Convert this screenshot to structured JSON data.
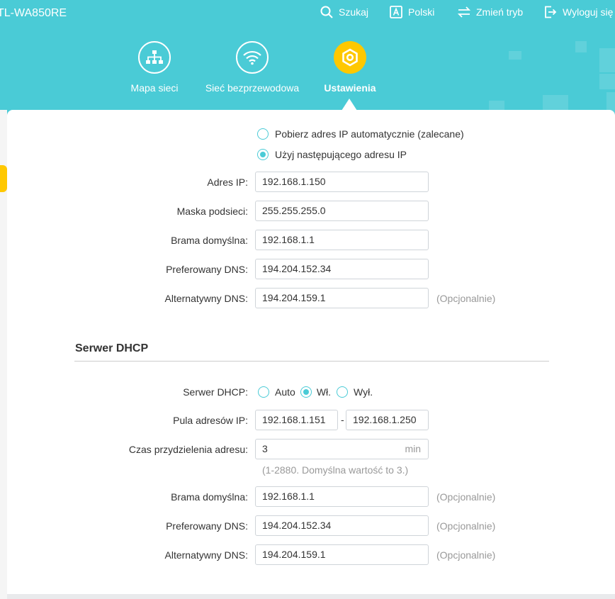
{
  "header": {
    "brand": "TL-WA850RE",
    "top_nav": [
      {
        "label": "Szukaj",
        "icon": "search-icon"
      },
      {
        "label": "Polski",
        "icon": "language-icon"
      },
      {
        "label": "Zmień tryb",
        "icon": "mode-switch-icon"
      },
      {
        "label": "Wyloguj się",
        "icon": "logout-icon"
      }
    ],
    "main_nav": [
      {
        "label": "Mapa sieci",
        "icon": "network-map-icon",
        "active": false
      },
      {
        "label": "Sieć bezprzewodowa",
        "icon": "wifi-icon",
        "active": false
      },
      {
        "label": "Ustawienia",
        "icon": "settings-icon",
        "active": true
      }
    ]
  },
  "ip_config": {
    "option_auto": "Pobierz adres IP automatycznie (zalecane)",
    "option_manual": "Użyj następującego adresu IP",
    "selected": "manual",
    "ip_address_label": "Adres IP:",
    "ip_address": "192.168.1.150",
    "subnet_label": "Maska podsieci:",
    "subnet": "255.255.255.0",
    "gateway_label": "Brama domyślna:",
    "gateway": "192.168.1.1",
    "dns1_label": "Preferowany DNS:",
    "dns1": "194.204.152.34",
    "dns2_label": "Alternatywny DNS:",
    "dns2": "194.204.159.1",
    "dns2_optional": "(Opcjonalnie)"
  },
  "dhcp": {
    "section_title": "Serwer DHCP",
    "server_label": "Serwer DHCP:",
    "mode_auto": "Auto",
    "mode_on": "Wł.",
    "mode_off": "Wył.",
    "selected_mode": "on",
    "pool_label": "Pula adresów IP:",
    "pool_start": "192.168.1.151",
    "pool_separator": "-",
    "pool_end": "192.168.1.250",
    "lease_label": "Czas przydzielenia adresu:",
    "lease_value": "3",
    "lease_unit": "min",
    "lease_hint": "(1-2880. Domyślna wartość to 3.)",
    "gateway_label": "Brama domyślna:",
    "gateway": "192.168.1.1",
    "gateway_optional": "(Opcjonalnie)",
    "dns1_label": "Preferowany DNS:",
    "dns1": "194.204.152.34",
    "dns1_optional": "(Opcjonalnie)",
    "dns2_label": "Alternatywny DNS:",
    "dns2": "194.204.159.1",
    "dns2_optional": "(Opcjonalnie)"
  },
  "colors": {
    "header_bg": "#4acbd6",
    "accent": "#ffc800",
    "radio": "#4acbd6"
  }
}
